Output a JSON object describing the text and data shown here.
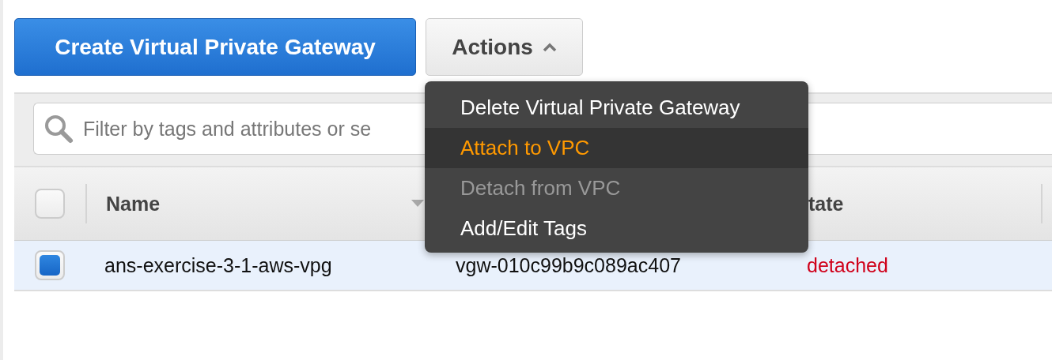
{
  "buttons": [
    {
      "label": "Create Virtual Private Gateway",
      "kind": "primary"
    },
    {
      "label": "Actions",
      "kind": "menu",
      "expanded": true
    }
  ],
  "actions_menu": {
    "items": [
      {
        "label": "Delete Virtual Private Gateway",
        "selected": false,
        "disabled": false
      },
      {
        "label": "Attach to VPC",
        "selected": true,
        "disabled": false
      },
      {
        "label": "Detach from VPC",
        "selected": false,
        "disabled": true
      },
      {
        "label": "Add/Edit Tags",
        "selected": false,
        "disabled": false
      }
    ]
  },
  "search": {
    "placeholder": "Filter by tags and attributes or se"
  },
  "table": {
    "header_checked": false,
    "columns": [
      {
        "label": "Name",
        "sorted": true
      },
      {
        "label": "tate",
        "sorted": false
      }
    ],
    "rows": [
      {
        "selected": true,
        "name": "ans-exercise-3-1-aws-vpg",
        "id": "vgw-010c99b9c089ac407",
        "state": "detached",
        "color": "#d0021b"
      }
    ]
  }
}
